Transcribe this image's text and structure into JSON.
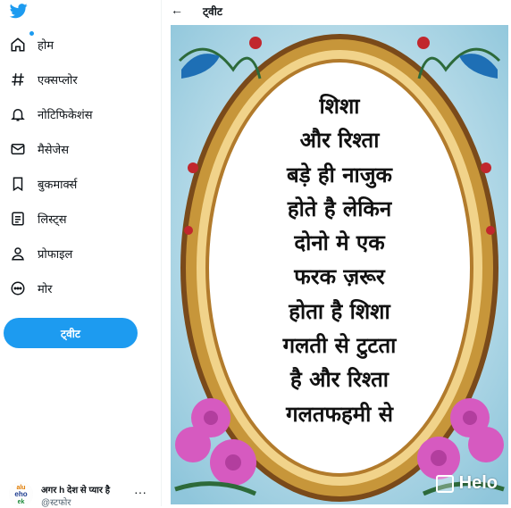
{
  "sidebar": {
    "items": [
      {
        "label": "होम",
        "icon": "home-icon"
      },
      {
        "label": "एक्सप्लोर",
        "icon": "hashtag-icon"
      },
      {
        "label": "नोटिफिकेशंस",
        "icon": "bell-icon"
      },
      {
        "label": "मैसेजेस",
        "icon": "mail-icon"
      },
      {
        "label": "बुकमार्क्स",
        "icon": "bookmark-icon"
      },
      {
        "label": "लिस्ट्स",
        "icon": "list-icon"
      },
      {
        "label": "प्रोफाइल",
        "icon": "person-icon"
      },
      {
        "label": "मोर",
        "icon": "more-circle-icon"
      }
    ],
    "tweet_button": "ट्वीट"
  },
  "account": {
    "name": "अगर h देश से प्यार है",
    "handle": "@स्टफोर",
    "avatar_text": [
      "alu",
      "eho",
      "ek"
    ]
  },
  "header": {
    "title": "ट्वीट"
  },
  "media": {
    "quote_lines": [
      "शिशा",
      "और रिश्ता",
      "बड़े ही नाजुक",
      "होते है लेकिन",
      "दोनो मे एक",
      "फरक ज़रूर",
      "होता है शिशा",
      "गलती से टुटता",
      "है और रिश्ता",
      "गलतफहमी से"
    ],
    "watermark": "Helo"
  },
  "colors": {
    "accent": "#1d9bf0",
    "frame": "#c7963a",
    "flower": "#d65ac0"
  }
}
